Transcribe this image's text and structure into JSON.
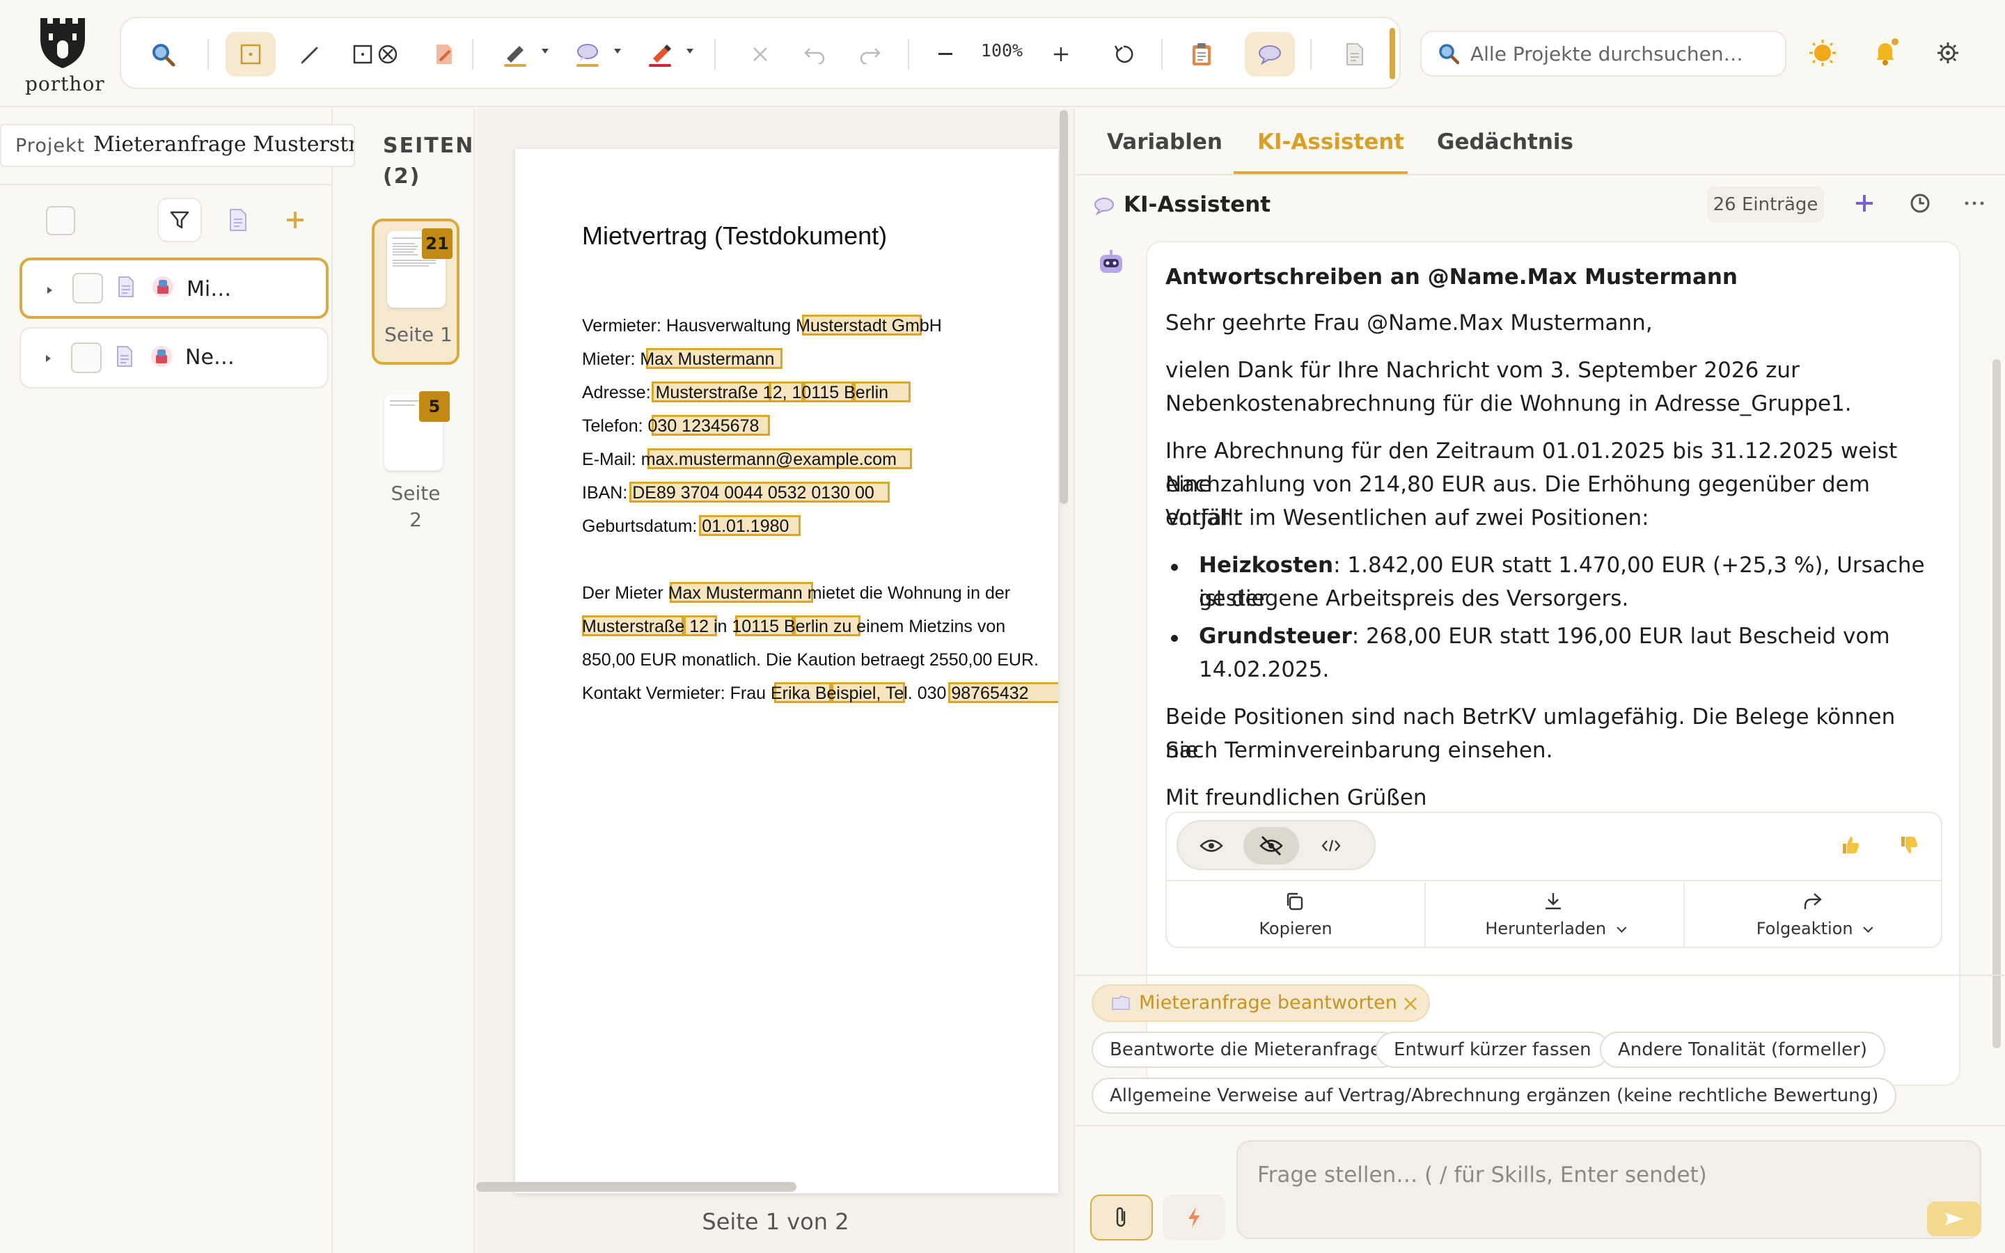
{
  "app": {
    "logo_text": "porthor"
  },
  "toolbar": {
    "zoom_value": "100%"
  },
  "search": {
    "placeholder": "Alle Projekte durchsuchen…"
  },
  "project": {
    "label": "Projekt",
    "name": "Mieteranfrage Musterstrasse"
  },
  "tree": {
    "items": [
      {
        "label": "Mi…",
        "selected": true
      },
      {
        "label": "Ne…",
        "selected": false
      }
    ]
  },
  "pages": {
    "title_line1": "SEITEN",
    "title_line2": "(2)",
    "thumbs": [
      {
        "badge": "21",
        "label": "Seite 1",
        "selected": true
      },
      {
        "badge": "5",
        "label_line1": "Seite",
        "label_line2": "2",
        "selected": false
      }
    ],
    "footer": "Seite 1 von 2"
  },
  "document": {
    "title": "Mietvertrag (Testdokument)",
    "lines": [
      "Vermieter: Hausverwaltung Musterstadt GmbH",
      "Mieter: Max Mustermann",
      "Adresse: Musterstraße 12, 10115 Berlin",
      "Telefon: 030 12345678",
      "E-Mail: max.mustermann@example.com",
      "IBAN: DE89 3704 0044 0532 0130 00",
      "Geburtsdatum: 01.01.1980",
      "Der Mieter Max Mustermann mietet die Wohnung in der",
      "Musterstraße 12 in 10115 Berlin zu einem Mietzins von",
      "850,00 EUR monatlich. Die Kaution betraegt 2550,00 EUR.",
      "Kontakt Vermieter: Frau Erika Beispiel, Tel. 030 98765432"
    ]
  },
  "right": {
    "tabs": [
      "Variablen",
      "KI-Assistent",
      "Gedächtnis"
    ],
    "active_tab": "KI-Assistent",
    "panel_title": "KI-Assistent",
    "entries": "26 Einträge",
    "message": {
      "heading": "Antwortschreiben an @Name.Max Mustermann",
      "salutation": "Sehr geehrte Frau @Name.Max Mustermann,",
      "p1_l1": "vielen Dank für Ihre Nachricht vom 3. September 2026 zur",
      "p1_l2": "Nebenkostenabrechnung für die Wohnung in Adresse_Gruppe1.",
      "p2_l1": "Ihre Abrechnung für den Zeitraum 01.01.2025 bis 31.12.2025 weist eine",
      "p2_l2": "Nachzahlung von 214,80 EUR aus. Die Erhöhung gegenüber dem Vorjahr",
      "p2_l3": "entfällt im Wesentlichen auf zwei Positionen:",
      "b1_term": "Heizkosten",
      "b1_l1": ": 1.842,00 EUR statt 1.470,00 EUR (+25,3 %), Ursache ist der",
      "b1_l2": "gestiegene Arbeitspreis des Versorgers.",
      "b2_term": "Grundsteuer",
      "b2_l1": ": 268,00 EUR statt 196,00 EUR laut Bescheid vom",
      "b2_l2": "14.02.2025.",
      "p3_l1": "Beide Positionen sind nach BetrKV umlagefähig. Die Belege können Sie",
      "p3_l2": "nach Terminvereinbarung einsehen.",
      "closing": "Mit freundlichen Grüßen"
    },
    "actions": {
      "copy": "Kopieren",
      "download": "Herunterladen",
      "followup": "Folgeaktion"
    },
    "skill_pill": "Mieteranfrage beantworten",
    "suggestions": [
      "Beantworte die Mieteranfrage",
      "Entwurf kürzer fassen",
      "Andere Tonalität (formeller)",
      "Allgemeine Verweise auf Vertrag/Abrechnung ergänzen (keine rechtliche Bewertung)"
    ],
    "input_placeholder": "Frage stellen… ( / für Skills, Enter sendet)"
  },
  "colors": {
    "accent": "#d9ab3f",
    "accent_text": "#d8a027",
    "highlight": "#e2b241",
    "background": "#faf8f3"
  },
  "icons": [
    "search-icon",
    "select-box-icon",
    "pen-icon",
    "redact-box-icon",
    "edit-doc-icon",
    "highlighter-icon",
    "comment-icon",
    "marker-icon",
    "close-icon",
    "undo-icon",
    "redo-icon",
    "zoom-out-icon",
    "zoom-in-icon",
    "rotate-icon",
    "clipboard-icon",
    "chat-icon",
    "document-icon",
    "sun-icon",
    "bell-icon",
    "gear-icon",
    "filter-icon",
    "add-icon",
    "robot-icon",
    "history-icon",
    "more-icon",
    "eye-icon",
    "eye-off-icon",
    "code-icon",
    "thumbs-up-icon",
    "thumbs-down-icon",
    "copy-icon",
    "download-icon",
    "share-icon",
    "attach-icon",
    "bolt-icon",
    "send-icon"
  ]
}
